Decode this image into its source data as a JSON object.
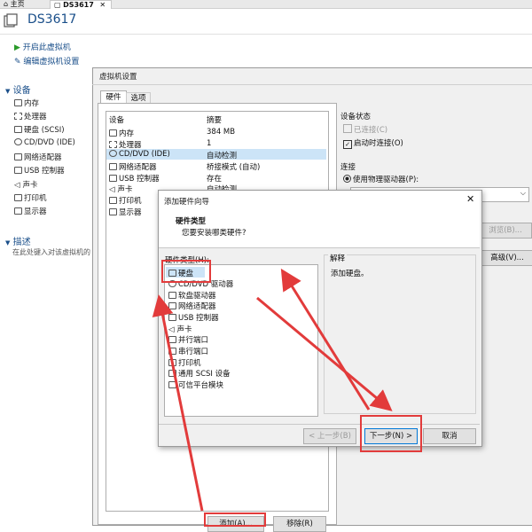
{
  "tabs": [
    {
      "label": "主页"
    },
    {
      "label": "DS3617"
    }
  ],
  "vm_title": "DS3617",
  "actions": {
    "power_on": "开启此虚拟机",
    "edit_settings": "编辑虚拟机设置"
  },
  "sidebar": {
    "devices_title": "设备",
    "devices": [
      {
        "label": "内存",
        "icon": "memory-icon"
      },
      {
        "label": "处理器",
        "icon": "cpu-icon"
      },
      {
        "label": "硬盘 (SCSI)",
        "icon": "disk-icon"
      },
      {
        "label": "CD/DVD (IDE)",
        "icon": "cd-icon"
      },
      {
        "label": "网络适配器",
        "icon": "network-icon"
      },
      {
        "label": "USB 控制器",
        "icon": "usb-icon"
      },
      {
        "label": "声卡",
        "icon": "sound-icon"
      },
      {
        "label": "打印机",
        "icon": "printer-icon"
      },
      {
        "label": "显示器",
        "icon": "monitor-icon"
      }
    ],
    "desc_title": "描述",
    "desc_placeholder": "在此处键入对该虚拟机的"
  },
  "settings_dialog": {
    "title": "虚拟机设置",
    "tabs": [
      "硬件",
      "选项"
    ],
    "col_device": "设备",
    "col_summary": "摘要",
    "rows": [
      {
        "device": "内存",
        "summary": "384 MB"
      },
      {
        "device": "处理器",
        "summary": "1"
      },
      {
        "device": "CD/DVD (IDE)",
        "summary": "自动检测"
      },
      {
        "device": "网络适配器",
        "summary": "桥接模式 (自动)"
      },
      {
        "device": "USB 控制器",
        "summary": "存在"
      },
      {
        "device": "声卡",
        "summary": "自动检测"
      },
      {
        "device": "打印机",
        "summary": ""
      },
      {
        "device": "显示器",
        "summary": ""
      }
    ],
    "device_status_title": "设备状态",
    "connected": "已连接(C)",
    "connect_on_power": "启动时连接(O)",
    "connection_title": "连接",
    "use_physical": "使用物理驱动器(P):",
    "browse": "浏览(B)...",
    "advanced": "高级(V)...",
    "add_btn": "添加(A)...",
    "remove_btn": "移除(R)"
  },
  "wizard": {
    "title": "添加硬件向导",
    "heading": "硬件类型",
    "subheading": "您要安装哪类硬件?",
    "list_label": "硬件类型(H):",
    "items": [
      "硬盘",
      "CD/DVD 驱动器",
      "软盘驱动器",
      "网络适配器",
      "USB 控制器",
      "声卡",
      "并行端口",
      "串行端口",
      "打印机",
      "通用 SCSI 设备",
      "可信平台模块"
    ],
    "explain_label": "解释",
    "explain_text": "添加硬盘。",
    "back_btn": "< 上一步(B)",
    "next_btn": "下一步(N) >",
    "cancel_btn": "取消"
  }
}
